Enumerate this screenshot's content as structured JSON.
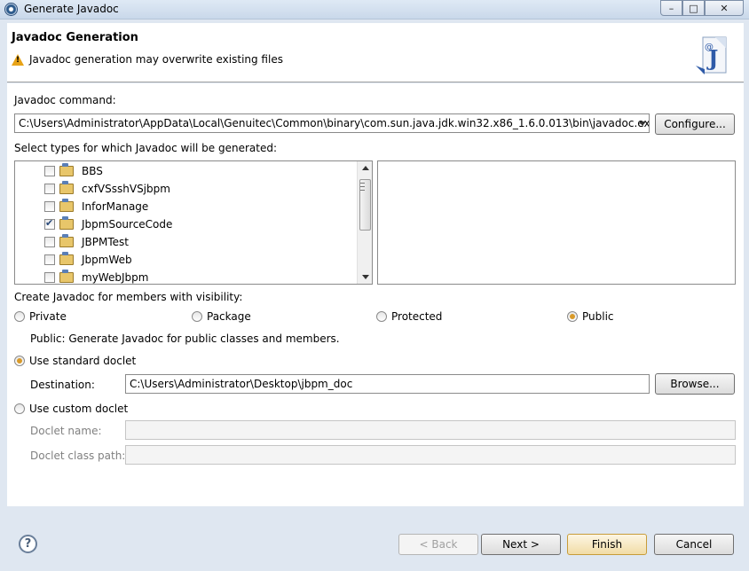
{
  "window": {
    "title": "Generate Javadoc",
    "buttons": [
      "–",
      "□",
      "✕"
    ]
  },
  "banner": {
    "title": "Javadoc Generation",
    "message": "Javadoc generation may overwrite existing files",
    "icon": "javadoc-wizard-icon"
  },
  "javadoc_command": {
    "label": "Javadoc command:",
    "value": "C:\\Users\\Administrator\\AppData\\Local\\Genuitec\\Common\\binary\\com.sun.java.jdk.win32.x86_1.6.0.013\\bin\\javadoc.exe",
    "configure_label": "Configure..."
  },
  "types": {
    "label": "Select types for which Javadoc will be generated:",
    "projects": [
      {
        "name": "BBS",
        "checked": false
      },
      {
        "name": "cxfVSsshVSjbpm",
        "checked": false
      },
      {
        "name": "InforManage",
        "checked": false
      },
      {
        "name": "JbpmSourceCode",
        "checked": true
      },
      {
        "name": "JBPMTest",
        "checked": false
      },
      {
        "name": "JbpmWeb",
        "checked": false
      },
      {
        "name": "myWebJbpm",
        "checked": false
      }
    ]
  },
  "visibility": {
    "label": "Create Javadoc for members with visibility:",
    "options": [
      "Private",
      "Package",
      "Protected",
      "Public"
    ],
    "selected": "Public",
    "description": "Public: Generate Javadoc for public classes and members."
  },
  "standard_doclet": {
    "label": "Use standard doclet",
    "selected": true,
    "destination_label": "Destination:",
    "destination_value": "C:\\Users\\Administrator\\Desktop\\jbpm_doc",
    "browse_label": "Browse..."
  },
  "custom_doclet": {
    "label": "Use custom doclet",
    "selected": false,
    "doclet_name_label": "Doclet name:",
    "doclet_class_path_label": "Doclet class path:"
  },
  "footer": {
    "help": "?",
    "back_label": "< Back",
    "next_label": "Next >",
    "finish_label": "Finish",
    "cancel_label": "Cancel"
  },
  "colors": {
    "accent": "#d89a2a",
    "warning": "#e8a317",
    "window_bg": "#dfe7f1"
  }
}
